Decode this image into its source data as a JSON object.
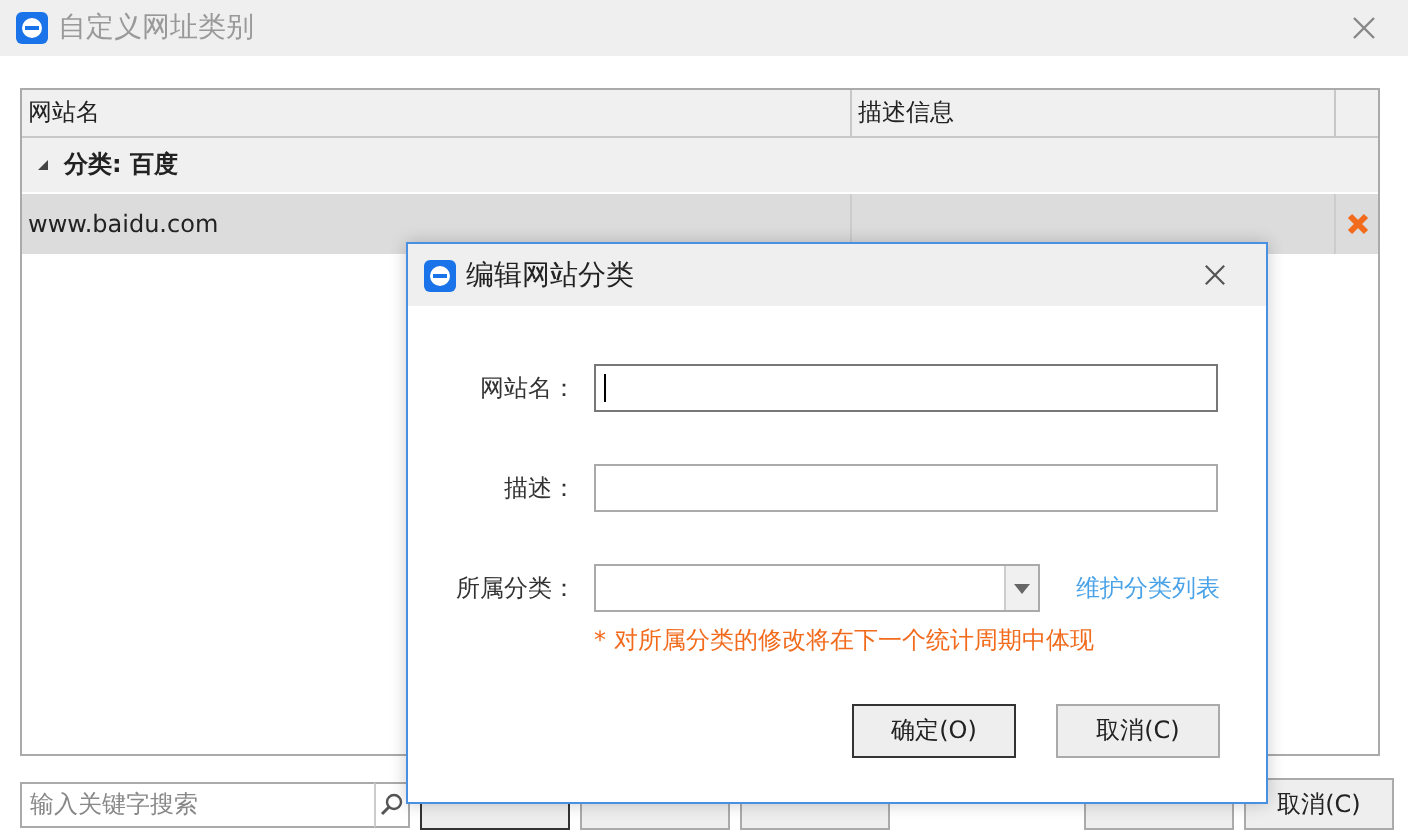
{
  "window": {
    "title": "自定义网址类别"
  },
  "table": {
    "columns": [
      "网站名",
      "描述信息"
    ],
    "groups": [
      {
        "label": "分类: 百度",
        "expanded": true,
        "rows": [
          {
            "name": "www.baidu.com",
            "selected": true
          }
        ]
      }
    ]
  },
  "search": {
    "placeholder": "输入关键字搜索"
  },
  "left_buttons": [
    {
      "default": true
    },
    {
      "default": false
    },
    {
      "default": false
    }
  ],
  "right_buttons": [
    {
      "default": false
    },
    {
      "label": "取消(C)",
      "default": false
    }
  ],
  "dialog": {
    "title": "编辑网站分类",
    "fields": [
      {
        "kind": "text",
        "label": "网站名：",
        "focused": true
      },
      {
        "kind": "text",
        "label": "描述：",
        "focused": false
      },
      {
        "kind": "combo",
        "label": "所属分类：",
        "focused": false,
        "link": "维护分类列表"
      }
    ],
    "note": "* 对所属分类的修改将在下一个统计周期中体现",
    "buttons": [
      {
        "label": "确定(O)",
        "default": true
      },
      {
        "label": "取消(C)",
        "default": false
      }
    ]
  }
}
